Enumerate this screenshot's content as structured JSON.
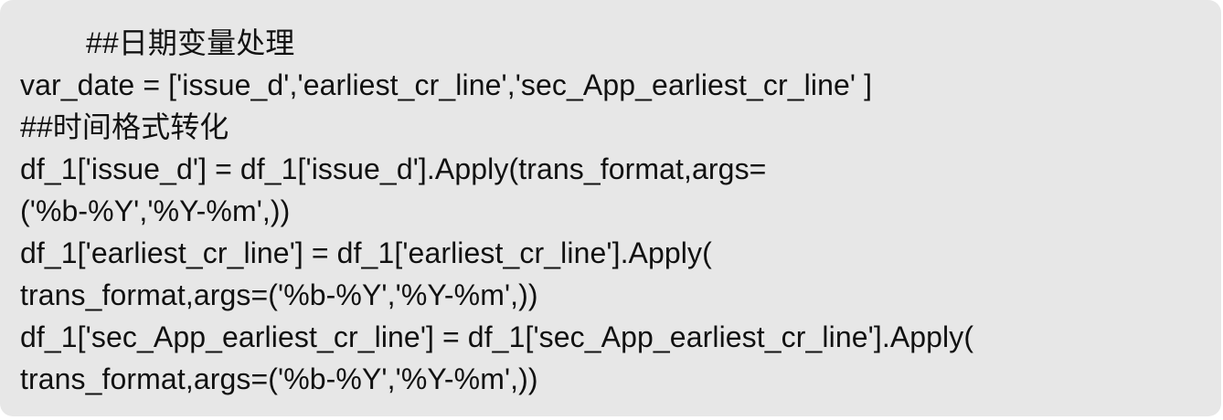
{
  "code": {
    "lines": [
      "##日期变量处理",
      "var_date = ['issue_d','earliest_cr_line','sec_App_earliest_cr_line' ]",
      "##时间格式转化",
      "df_1['issue_d'] = df_1['issue_d'].Apply(trans_format,args=",
      "('%b-%Y','%Y-%m',))",
      "df_1['earliest_cr_line'] = df_1['earliest_cr_line'].Apply(",
      "trans_format,args=('%b-%Y','%Y-%m',))",
      "df_1['sec_App_earliest_cr_line'] = df_1['sec_App_earliest_cr_line'].Apply(",
      "trans_format,args=('%b-%Y','%Y-%m',))"
    ]
  }
}
